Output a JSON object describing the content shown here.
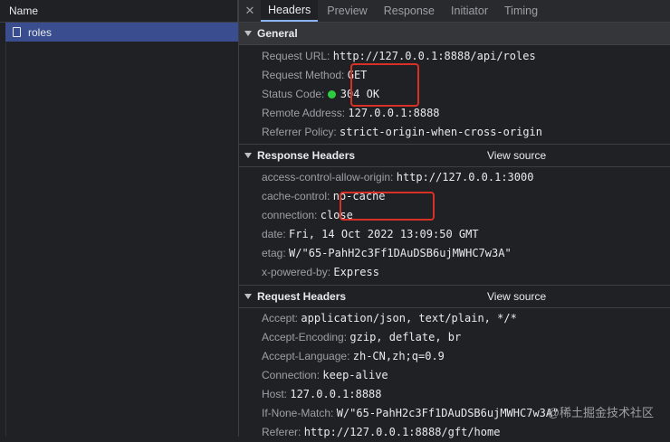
{
  "left": {
    "header": "Name",
    "requests": [
      {
        "name": "roles"
      }
    ]
  },
  "tabs": {
    "close_icon": "close-icon",
    "items": [
      "Headers",
      "Preview",
      "Response",
      "Initiator",
      "Timing"
    ],
    "active": "Headers"
  },
  "general": {
    "title": "General",
    "rows": [
      {
        "key": "Request URL:",
        "value": "http://127.0.0.1:8888/api/roles"
      },
      {
        "key": "Request Method:",
        "value": "GET"
      },
      {
        "key": "Status Code:",
        "value": "304 OK"
      },
      {
        "key": "Remote Address:",
        "value": "127.0.0.1:8888"
      },
      {
        "key": "Referrer Policy:",
        "value": "strict-origin-when-cross-origin"
      }
    ]
  },
  "response_headers": {
    "title": "Response Headers",
    "view_source": "View source",
    "rows": [
      {
        "key": "access-control-allow-origin:",
        "value": "http://127.0.0.1:3000"
      },
      {
        "key": "cache-control:",
        "value": "no-cache"
      },
      {
        "key": "connection:",
        "value": "close"
      },
      {
        "key": "date:",
        "value": "Fri, 14 Oct 2022 13:09:50 GMT"
      },
      {
        "key": "etag:",
        "value": "W/\"65-PahH2c3Ff1DAuDSB6ujMWHC7w3A\""
      },
      {
        "key": "x-powered-by:",
        "value": "Express"
      }
    ]
  },
  "request_headers": {
    "title": "Request Headers",
    "view_source": "View source",
    "rows": [
      {
        "key": "Accept:",
        "value": "application/json, text/plain, */*"
      },
      {
        "key": "Accept-Encoding:",
        "value": "gzip, deflate, br"
      },
      {
        "key": "Accept-Language:",
        "value": "zh-CN,zh;q=0.9"
      },
      {
        "key": "Connection:",
        "value": "keep-alive"
      },
      {
        "key": "Host:",
        "value": "127.0.0.1:8888"
      },
      {
        "key": "If-None-Match:",
        "value": "W/\"65-PahH2c3Ff1DAuDSB6ujMWHC7w3A\""
      },
      {
        "key": "Referer:",
        "value": "http://127.0.0.1:8888/gft/home"
      }
    ]
  },
  "status_color": "#2ecc40",
  "watermark": "@稀土掘金技术社区"
}
